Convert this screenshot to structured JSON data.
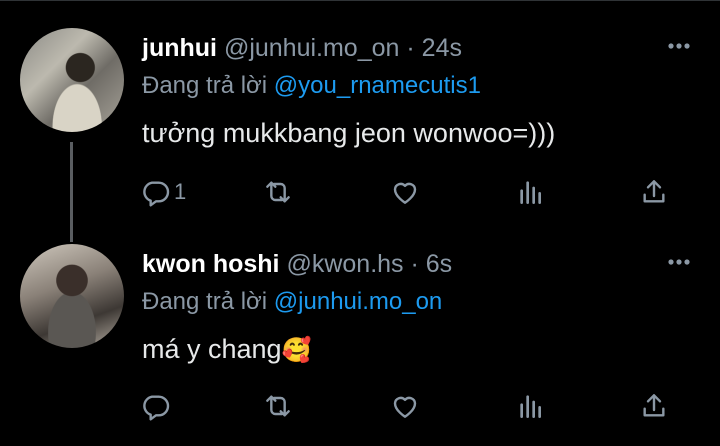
{
  "tweets": [
    {
      "name": "junhui",
      "handle": "@junhui.mo_on",
      "separator": "·",
      "time": "24s",
      "reply_prefix": "Đang trả lời",
      "reply_to": "@you_rnamecutis1",
      "text": "tưởng mukkbang jeon wonwoo=)))",
      "emoji": "",
      "reply_count": "1"
    },
    {
      "name": "kwon hoshi",
      "handle": "@kwon.hs",
      "separator": "·",
      "time": "6s",
      "reply_prefix": "Đang trả lời",
      "reply_to": "@junhui.mo_on",
      "text": "má y chang",
      "emoji": "🥰",
      "reply_count": ""
    }
  ],
  "icons": {
    "reply": "reply-icon",
    "retweet": "retweet-icon",
    "like": "heart-icon",
    "analytics": "analytics-icon",
    "share": "share-icon",
    "more": "more-icon",
    "avatar": "avatar"
  },
  "colors": {
    "background": "#000000",
    "text": "#e7e9ea",
    "muted": "#8b98a5",
    "link": "#1d9bf0",
    "thread_line": "#5a5d61"
  }
}
